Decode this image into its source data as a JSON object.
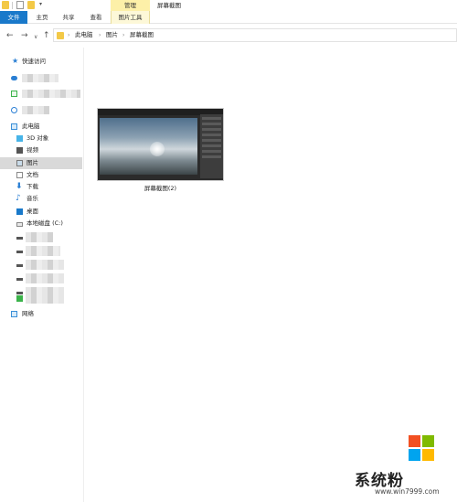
{
  "titlebar": {
    "manage_label": "管理",
    "window_title": "屏幕截图",
    "dropdown_glyph": "▾"
  },
  "ribbon": {
    "file": "文件",
    "home": "主页",
    "share": "共享",
    "view": "查看",
    "picture_tools": "图片工具"
  },
  "nav": {
    "back": "←",
    "forward": "→",
    "recent": "∨",
    "up": "↑"
  },
  "address": {
    "separator": "›",
    "crumbs": [
      "此电脑",
      "图片",
      "屏幕截图"
    ]
  },
  "sidebar": {
    "quick_access": "快速访问",
    "this_pc": "此电脑",
    "objects_3d": "3D 对象",
    "videos": "视频",
    "pictures": "图片",
    "documents": "文档",
    "downloads": "下载",
    "music": "音乐",
    "desktop": "桌面",
    "local_disk": "本地磁盘 (C:)",
    "network": "网络"
  },
  "files": [
    {
      "name": "屏幕截图(2)"
    }
  ],
  "watermark": {
    "brand": "系统粉",
    "url": "www.win7999.com"
  },
  "colors": {
    "file_tab": "#1979ca",
    "manage_tab": "#fdf0a8",
    "selected_item": "#d9d9d9",
    "folder": "#f3c947"
  }
}
